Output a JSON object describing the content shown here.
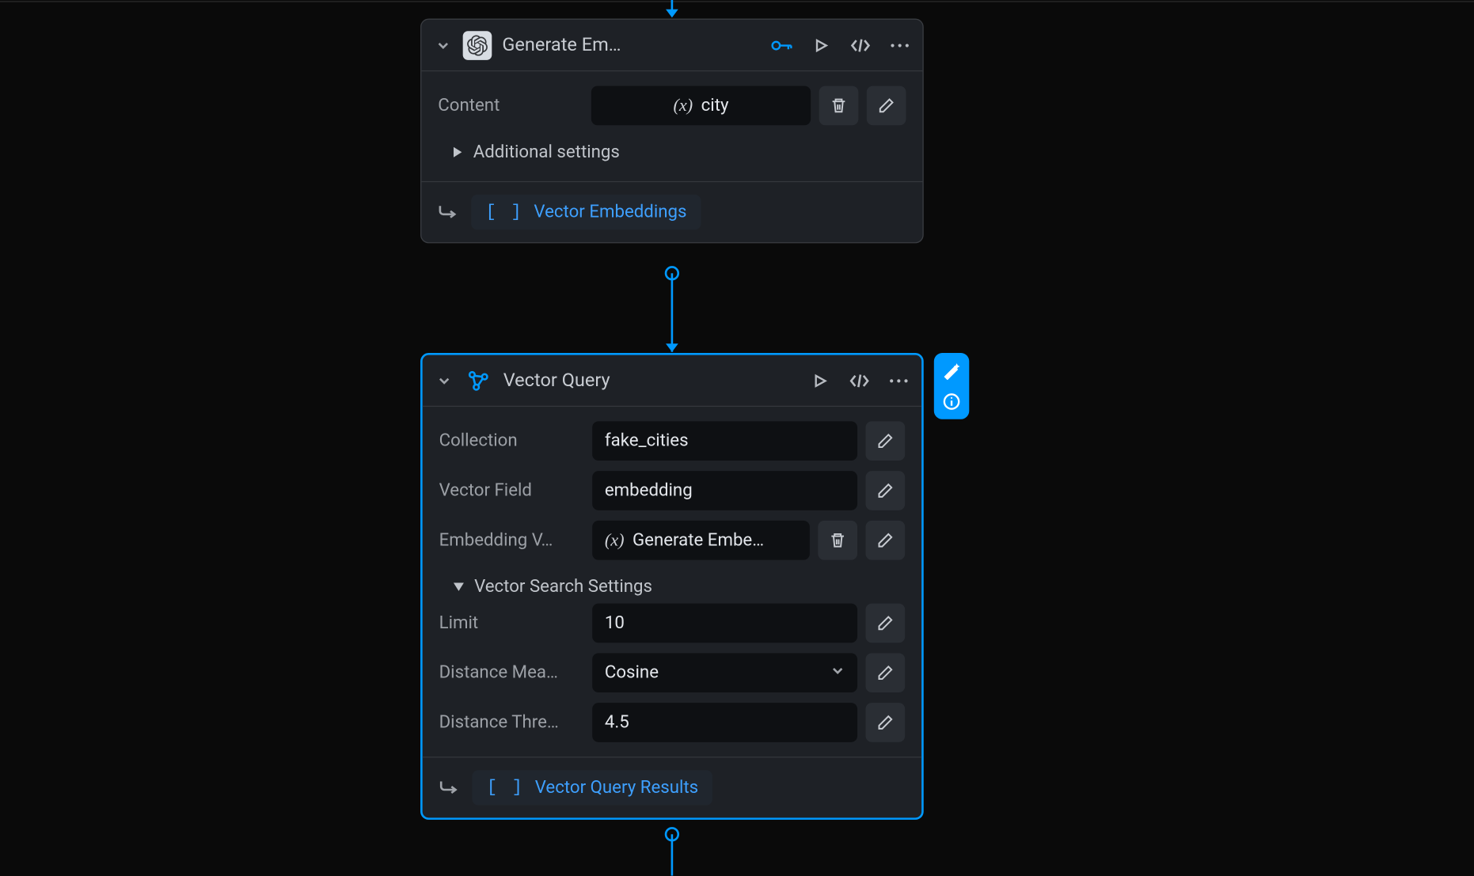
{
  "node1": {
    "title": "Generate Em…",
    "content_label": "Content",
    "content_var": "city",
    "additional_settings": "Additional settings",
    "output_label": "Vector Embeddings"
  },
  "node2": {
    "title": "Vector Query",
    "fields": {
      "collection_label": "Collection",
      "collection_value": "fake_cities",
      "vector_field_label": "Vector Field",
      "vector_field_value": "embedding",
      "embedding_label": "Embedding V…",
      "embedding_value": "Generate Embe…",
      "section_title": "Vector Search Settings",
      "limit_label": "Limit",
      "limit_value": "10",
      "distance_measure_label": "Distance Mea…",
      "distance_measure_value": "Cosine",
      "distance_threshold_label": "Distance Thre…",
      "distance_threshold_value": "4.5"
    },
    "output_label": "Vector Query Results"
  },
  "var_symbol": "(x)",
  "brackets": "[ ]"
}
